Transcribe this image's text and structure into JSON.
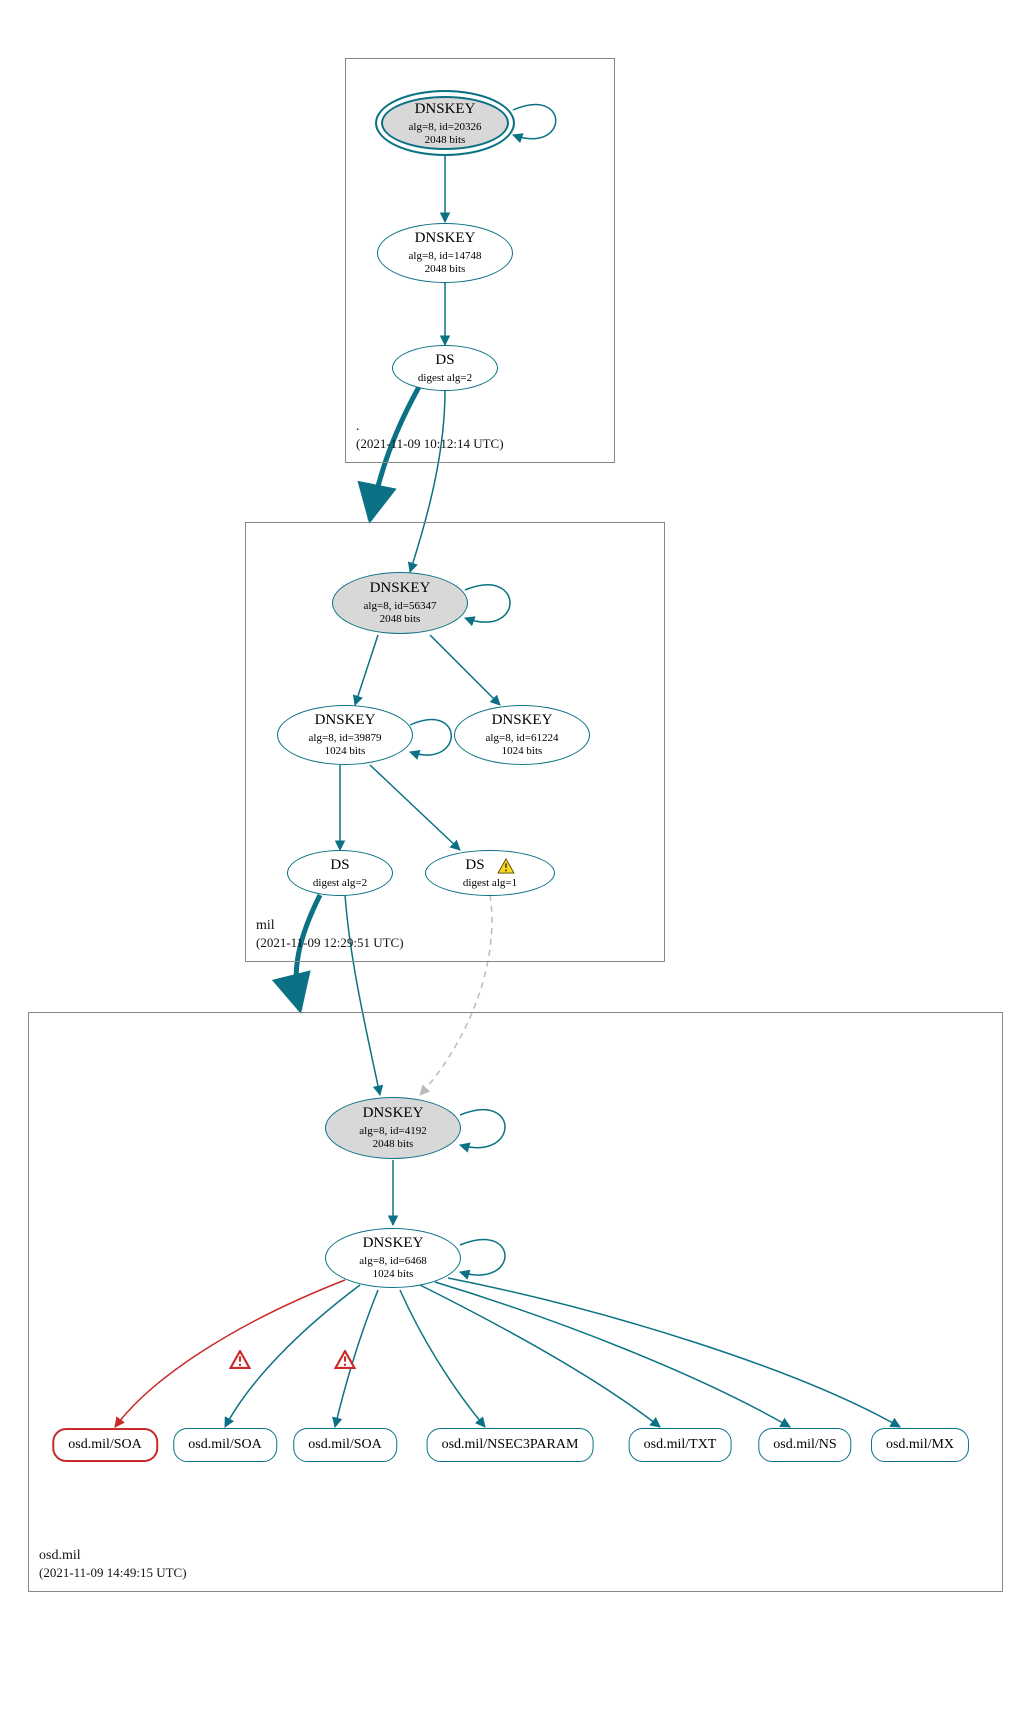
{
  "colors": {
    "teal": "#0b7285",
    "red": "#c92a2a",
    "grey": "#bbbbbb",
    "warn_fill": "#f9d71c",
    "warn_stroke": "#5a4a00"
  },
  "zones": {
    "root": {
      "name": ".",
      "ts": "(2021-11-09 10:12:14 UTC)"
    },
    "mil": {
      "name": "mil",
      "ts": "(2021-11-09 12:29:51 UTC)"
    },
    "osd": {
      "name": "osd.mil",
      "ts": "(2021-11-09 14:49:15 UTC)"
    }
  },
  "nodes": {
    "root_ksk": {
      "title": "DNSKEY",
      "line2": "alg=8, id=20326",
      "line3": "2048 bits"
    },
    "root_zsk": {
      "title": "DNSKEY",
      "line2": "alg=8, id=14748",
      "line3": "2048 bits"
    },
    "root_ds": {
      "title": "DS",
      "line2": "digest alg=2"
    },
    "mil_ksk": {
      "title": "DNSKEY",
      "line2": "alg=8, id=56347",
      "line3": "2048 bits"
    },
    "mil_zsk": {
      "title": "DNSKEY",
      "line2": "alg=8, id=39879",
      "line3": "1024 bits"
    },
    "mil_zsk2": {
      "title": "DNSKEY",
      "line2": "alg=8, id=61224",
      "line3": "1024 bits"
    },
    "mil_ds1": {
      "title": "DS",
      "line2": "digest alg=2"
    },
    "mil_ds2": {
      "title": "DS",
      "line2": "digest alg=1"
    },
    "osd_ksk": {
      "title": "DNSKEY",
      "line2": "alg=8, id=4192",
      "line3": "2048 bits"
    },
    "osd_zsk": {
      "title": "DNSKEY",
      "line2": "alg=8, id=6468",
      "line3": "1024 bits"
    }
  },
  "rrsets": {
    "r1": "osd.mil/SOA",
    "r2": "osd.mil/SOA",
    "r3": "osd.mil/SOA",
    "r4": "osd.mil/NSEC3PARAM",
    "r5": "osd.mil/TXT",
    "r6": "osd.mil/NS",
    "r7": "osd.mil/MX"
  }
}
